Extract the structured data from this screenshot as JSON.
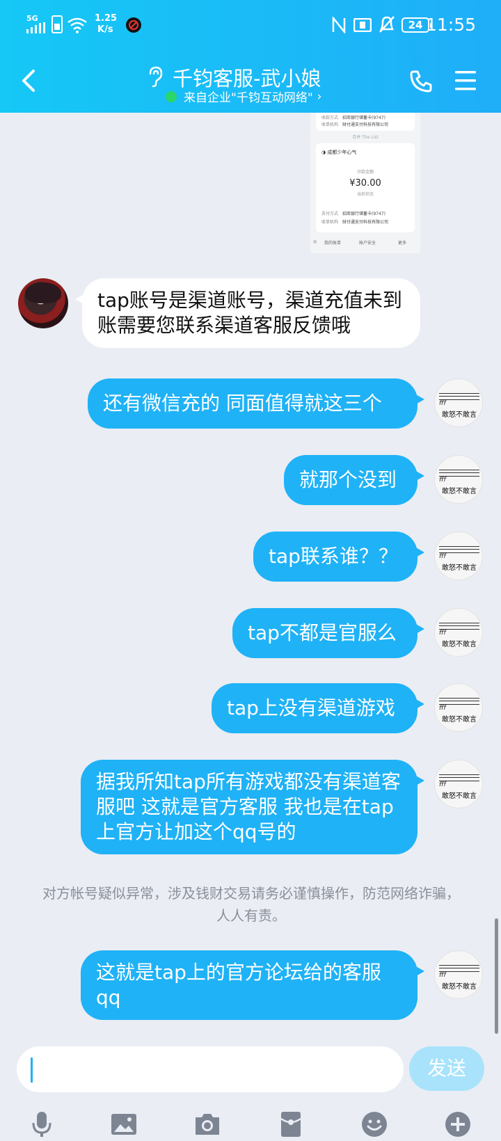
{
  "status_bar": {
    "network": "5G",
    "speed_value": "1.25",
    "speed_unit": "K/s",
    "battery": "24",
    "time": "11:55"
  },
  "header": {
    "title": "千钧客服-武小娘",
    "subtitle": "来自企业\"千钧互动网络\""
  },
  "receipt": {
    "top_rows": [
      {
        "label": "收款方式",
        "value": "招商银行储蓄卡(9747)"
      },
      {
        "label": "收单机构",
        "value": "财付通支付科技有限公司"
      }
    ],
    "divider_text": "合并 The List",
    "merchant": "成都少年心气",
    "paid_label": "付款金额",
    "amount": "¥30.00",
    "status": "当前状态",
    "rows": [
      {
        "label": "支付方式",
        "value": "招商银行储蓄卡(9747)"
      },
      {
        "label": "收单机构",
        "value": "财付通支付科技有限公司"
      }
    ],
    "bottom_links": [
      "我的账单",
      "账户安全",
      "更多"
    ]
  },
  "messages": {
    "m1": "tap账号是渠道账号，渠道充值未到账需要您联系渠道客服反馈哦",
    "m2": "还有微信充的 同面值得就这三个",
    "m3": "就那个没到",
    "m4": "tap联系谁？？",
    "m5": "tap不都是官服么",
    "m6": "tap上没有渠道游戏",
    "m7": "据我所知tap所有游戏都没有渠道客服吧 这就是官方客服 我也是在tap上官方让加这个qq号的",
    "m8": "这就是tap上的官方论坛给的客服qq"
  },
  "self_avatar": {
    "text": "敢怒不敢言",
    "mark": "fff"
  },
  "notice": "对方帐号疑似异常，涉及钱财交易请务必谨慎操作，防范网络诈骗，人人有责。",
  "input": {
    "value": "",
    "send_label": "发送"
  },
  "toolbar": [
    "mic-icon",
    "image-icon",
    "camera-icon",
    "red-packet-icon",
    "emoji-icon",
    "plus-icon"
  ]
}
